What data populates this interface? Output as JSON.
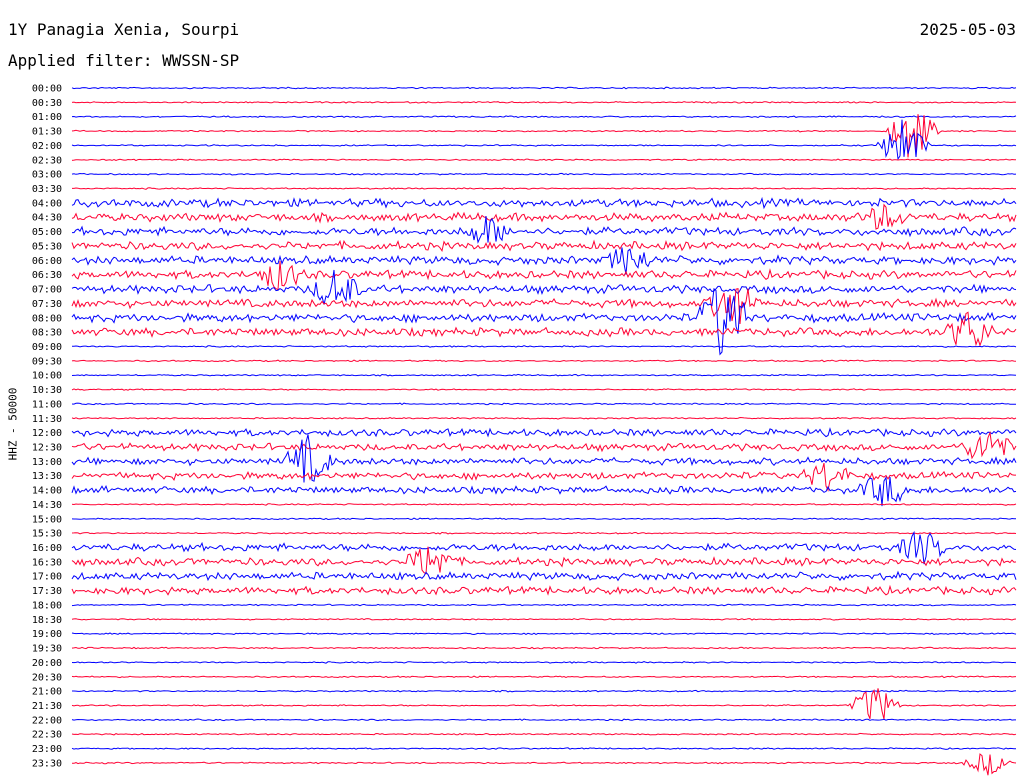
{
  "header": {
    "station": "1Y Panagia Xenia, Sourpi",
    "date": "2025-05-03",
    "filter": "Applied filter: WWSSN-SP"
  },
  "y_axis_label": "HHZ - 50000",
  "colors": {
    "trace_a": "#0000ff",
    "trace_b": "#ff0033",
    "text": "#000000",
    "background": "#ffffff"
  },
  "chart_data": {
    "type": "helicorder",
    "ylabel": "HHZ - 50000",
    "row_labels": [
      "00:00",
      "00:30",
      "01:00",
      "01:30",
      "02:00",
      "02:30",
      "03:00",
      "03:30",
      "04:00",
      "04:30",
      "05:00",
      "05:30",
      "06:00",
      "06:30",
      "07:00",
      "07:30",
      "08:00",
      "08:30",
      "09:00",
      "09:30",
      "10:00",
      "10:30",
      "11:00",
      "11:30",
      "12:00",
      "12:30",
      "13:00",
      "13:30",
      "14:00",
      "14:30",
      "15:00",
      "15:30",
      "16:00",
      "16:30",
      "17:00",
      "17:30",
      "18:00",
      "18:30",
      "19:00",
      "19:30",
      "20:00",
      "20:30",
      "21:00",
      "21:30",
      "22:00",
      "22:30",
      "23:00",
      "23:30"
    ],
    "trace_colors_alternating": [
      "blue",
      "red"
    ],
    "events": [
      {
        "row": "01:30",
        "t": 0.89,
        "amp": 1.4
      },
      {
        "row": "02:00",
        "t": 0.88,
        "amp": 1.2
      },
      {
        "row": "04:30",
        "t": 0.86,
        "amp": 0.5
      },
      {
        "row": "05:00",
        "t": 0.44,
        "amp": 0.6
      },
      {
        "row": "06:00",
        "t": 0.59,
        "amp": 0.6
      },
      {
        "row": "06:30",
        "t": 0.22,
        "amp": 0.6
      },
      {
        "row": "07:00",
        "t": 0.28,
        "amp": 0.9
      },
      {
        "row": "07:30",
        "t": 0.7,
        "amp": 1.0
      },
      {
        "row": "08:00",
        "t": 0.69,
        "amp": 1.8
      },
      {
        "row": "08:30",
        "t": 0.95,
        "amp": 0.9
      },
      {
        "row": "12:30",
        "t": 0.97,
        "amp": 0.8
      },
      {
        "row": "13:00",
        "t": 0.25,
        "amp": 1.0
      },
      {
        "row": "13:30",
        "t": 0.8,
        "amp": 0.6
      },
      {
        "row": "14:00",
        "t": 0.86,
        "amp": 0.7
      },
      {
        "row": "16:00",
        "t": 0.9,
        "amp": 0.7
      },
      {
        "row": "16:30",
        "t": 0.38,
        "amp": 0.8
      },
      {
        "row": "21:30",
        "t": 0.85,
        "amp": 0.9
      },
      {
        "row": "23:30",
        "t": 0.97,
        "amp": 0.5
      }
    ],
    "grid": false
  }
}
